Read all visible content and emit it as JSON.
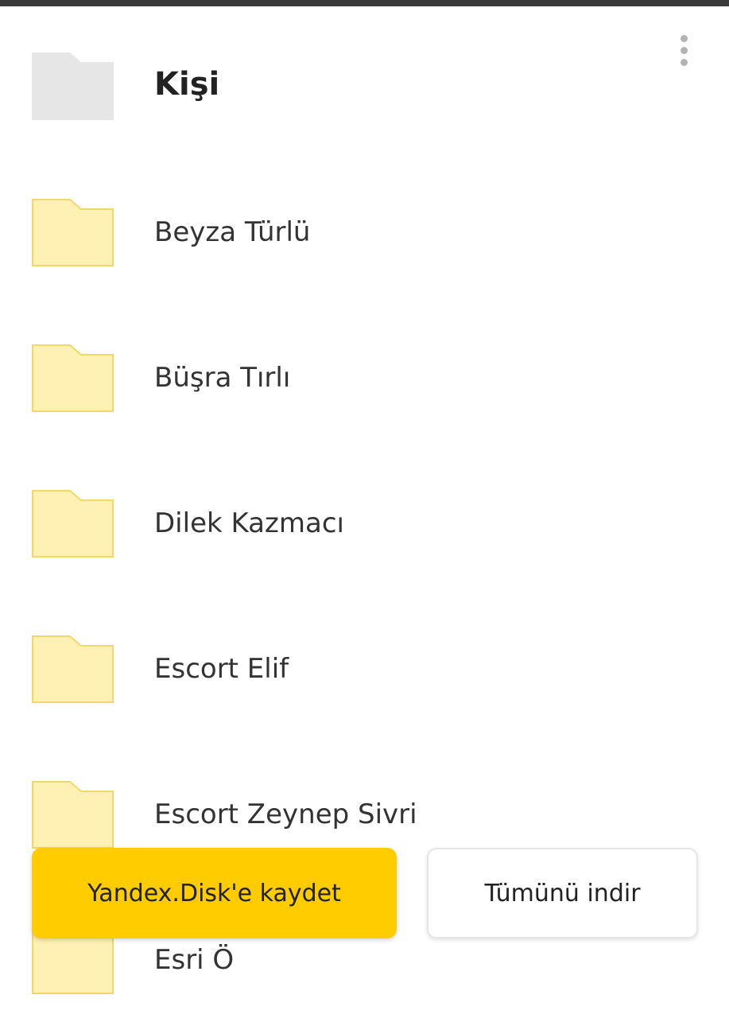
{
  "header": {
    "title": "Kişi",
    "folder_icon": "folder-icon",
    "folder_color": "#e6e6e6",
    "more_icon": "more-vertical-icon"
  },
  "folders": [
    {
      "name": "Beyza Türlü",
      "icon": "folder-icon"
    },
    {
      "name": "Büşra Tırlı",
      "icon": "folder-icon"
    },
    {
      "name": "Dilek Kazmacı",
      "icon": "folder-icon"
    },
    {
      "name": "Escort Elif",
      "icon": "folder-icon"
    },
    {
      "name": "Escort Zeynep Sivri",
      "icon": "folder-icon"
    },
    {
      "name": "Esri Ö",
      "icon": "folder-icon"
    }
  ],
  "folder_colors": {
    "fill": "#fff1b3",
    "stroke": "#f2d76a"
  },
  "actions": {
    "save_label": "Yandex.Disk'e kaydet",
    "download_all_label": "Tümünü indir",
    "accent": "#ffcc00"
  }
}
